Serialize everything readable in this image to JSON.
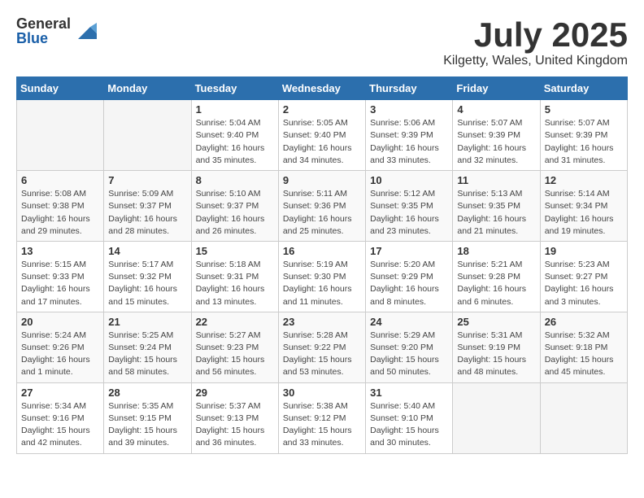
{
  "app": {
    "name_general": "General",
    "name_blue": "Blue"
  },
  "title": "July 2025",
  "location": "Kilgetty, Wales, United Kingdom",
  "weekdays": [
    "Sunday",
    "Monday",
    "Tuesday",
    "Wednesday",
    "Thursday",
    "Friday",
    "Saturday"
  ],
  "weeks": [
    [
      {
        "day": "",
        "info": ""
      },
      {
        "day": "",
        "info": ""
      },
      {
        "day": "1",
        "info": "Sunrise: 5:04 AM\nSunset: 9:40 PM\nDaylight: 16 hours\nand 35 minutes."
      },
      {
        "day": "2",
        "info": "Sunrise: 5:05 AM\nSunset: 9:40 PM\nDaylight: 16 hours\nand 34 minutes."
      },
      {
        "day": "3",
        "info": "Sunrise: 5:06 AM\nSunset: 9:39 PM\nDaylight: 16 hours\nand 33 minutes."
      },
      {
        "day": "4",
        "info": "Sunrise: 5:07 AM\nSunset: 9:39 PM\nDaylight: 16 hours\nand 32 minutes."
      },
      {
        "day": "5",
        "info": "Sunrise: 5:07 AM\nSunset: 9:39 PM\nDaylight: 16 hours\nand 31 minutes."
      }
    ],
    [
      {
        "day": "6",
        "info": "Sunrise: 5:08 AM\nSunset: 9:38 PM\nDaylight: 16 hours\nand 29 minutes."
      },
      {
        "day": "7",
        "info": "Sunrise: 5:09 AM\nSunset: 9:37 PM\nDaylight: 16 hours\nand 28 minutes."
      },
      {
        "day": "8",
        "info": "Sunrise: 5:10 AM\nSunset: 9:37 PM\nDaylight: 16 hours\nand 26 minutes."
      },
      {
        "day": "9",
        "info": "Sunrise: 5:11 AM\nSunset: 9:36 PM\nDaylight: 16 hours\nand 25 minutes."
      },
      {
        "day": "10",
        "info": "Sunrise: 5:12 AM\nSunset: 9:35 PM\nDaylight: 16 hours\nand 23 minutes."
      },
      {
        "day": "11",
        "info": "Sunrise: 5:13 AM\nSunset: 9:35 PM\nDaylight: 16 hours\nand 21 minutes."
      },
      {
        "day": "12",
        "info": "Sunrise: 5:14 AM\nSunset: 9:34 PM\nDaylight: 16 hours\nand 19 minutes."
      }
    ],
    [
      {
        "day": "13",
        "info": "Sunrise: 5:15 AM\nSunset: 9:33 PM\nDaylight: 16 hours\nand 17 minutes."
      },
      {
        "day": "14",
        "info": "Sunrise: 5:17 AM\nSunset: 9:32 PM\nDaylight: 16 hours\nand 15 minutes."
      },
      {
        "day": "15",
        "info": "Sunrise: 5:18 AM\nSunset: 9:31 PM\nDaylight: 16 hours\nand 13 minutes."
      },
      {
        "day": "16",
        "info": "Sunrise: 5:19 AM\nSunset: 9:30 PM\nDaylight: 16 hours\nand 11 minutes."
      },
      {
        "day": "17",
        "info": "Sunrise: 5:20 AM\nSunset: 9:29 PM\nDaylight: 16 hours\nand 8 minutes."
      },
      {
        "day": "18",
        "info": "Sunrise: 5:21 AM\nSunset: 9:28 PM\nDaylight: 16 hours\nand 6 minutes."
      },
      {
        "day": "19",
        "info": "Sunrise: 5:23 AM\nSunset: 9:27 PM\nDaylight: 16 hours\nand 3 minutes."
      }
    ],
    [
      {
        "day": "20",
        "info": "Sunrise: 5:24 AM\nSunset: 9:26 PM\nDaylight: 16 hours\nand 1 minute."
      },
      {
        "day": "21",
        "info": "Sunrise: 5:25 AM\nSunset: 9:24 PM\nDaylight: 15 hours\nand 58 minutes."
      },
      {
        "day": "22",
        "info": "Sunrise: 5:27 AM\nSunset: 9:23 PM\nDaylight: 15 hours\nand 56 minutes."
      },
      {
        "day": "23",
        "info": "Sunrise: 5:28 AM\nSunset: 9:22 PM\nDaylight: 15 hours\nand 53 minutes."
      },
      {
        "day": "24",
        "info": "Sunrise: 5:29 AM\nSunset: 9:20 PM\nDaylight: 15 hours\nand 50 minutes."
      },
      {
        "day": "25",
        "info": "Sunrise: 5:31 AM\nSunset: 9:19 PM\nDaylight: 15 hours\nand 48 minutes."
      },
      {
        "day": "26",
        "info": "Sunrise: 5:32 AM\nSunset: 9:18 PM\nDaylight: 15 hours\nand 45 minutes."
      }
    ],
    [
      {
        "day": "27",
        "info": "Sunrise: 5:34 AM\nSunset: 9:16 PM\nDaylight: 15 hours\nand 42 minutes."
      },
      {
        "day": "28",
        "info": "Sunrise: 5:35 AM\nSunset: 9:15 PM\nDaylight: 15 hours\nand 39 minutes."
      },
      {
        "day": "29",
        "info": "Sunrise: 5:37 AM\nSunset: 9:13 PM\nDaylight: 15 hours\nand 36 minutes."
      },
      {
        "day": "30",
        "info": "Sunrise: 5:38 AM\nSunset: 9:12 PM\nDaylight: 15 hours\nand 33 minutes."
      },
      {
        "day": "31",
        "info": "Sunrise: 5:40 AM\nSunset: 9:10 PM\nDaylight: 15 hours\nand 30 minutes."
      },
      {
        "day": "",
        "info": ""
      },
      {
        "day": "",
        "info": ""
      }
    ]
  ]
}
